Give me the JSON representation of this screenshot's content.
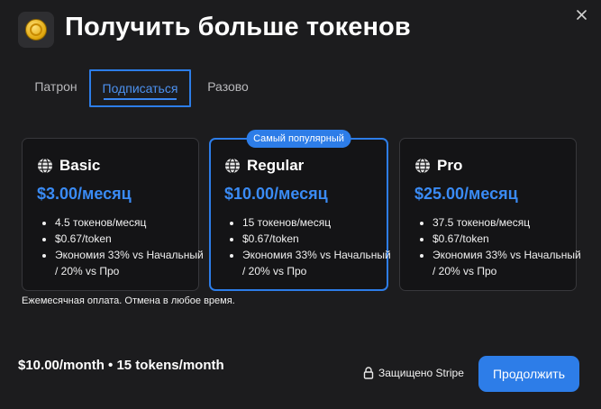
{
  "dialog": {
    "title": "Получить больше токенов",
    "app_icon": "coin-icon",
    "close_icon": "close-icon"
  },
  "tabs": [
    {
      "label": "Патрон",
      "active": false
    },
    {
      "label": "Подписаться",
      "active": true
    },
    {
      "label": "Разово",
      "active": false
    }
  ],
  "plans": [
    {
      "name": "Basic",
      "icon": "globe-icon",
      "price": "$3.00/месяц",
      "features": [
        "4.5 токенов/месяц",
        "$0.67/token",
        "Экономия 33% vs Начальный / 20% vs Про"
      ],
      "selected": false
    },
    {
      "name": "Regular",
      "icon": "globe-icon",
      "badge": "Самый популярный",
      "price": "$10.00/месяц",
      "features": [
        "15 токенов/месяц",
        "$0.67/token",
        "Экономия 33% vs Начальный / 20% vs Про"
      ],
      "selected": true
    },
    {
      "name": "Pro",
      "icon": "globe-icon",
      "price": "$25.00/месяц",
      "features": [
        "37.5 токенов/месяц",
        "$0.67/token",
        "Экономия 33% vs Начальный / 20% vs Про"
      ],
      "selected": false
    }
  ],
  "billing_note": "Ежемесячная оплата. Отмена в любое время.",
  "footer": {
    "summary": "$10.00/month • 15 tokens/month",
    "secure_label": "Защищено Stripe",
    "secure_icon": "lock-icon",
    "continue_label": "Продолжить"
  },
  "colors": {
    "accent": "#2d7de8",
    "price": "#3a8bf5",
    "background": "#1c1c1e",
    "card": "#141416"
  }
}
